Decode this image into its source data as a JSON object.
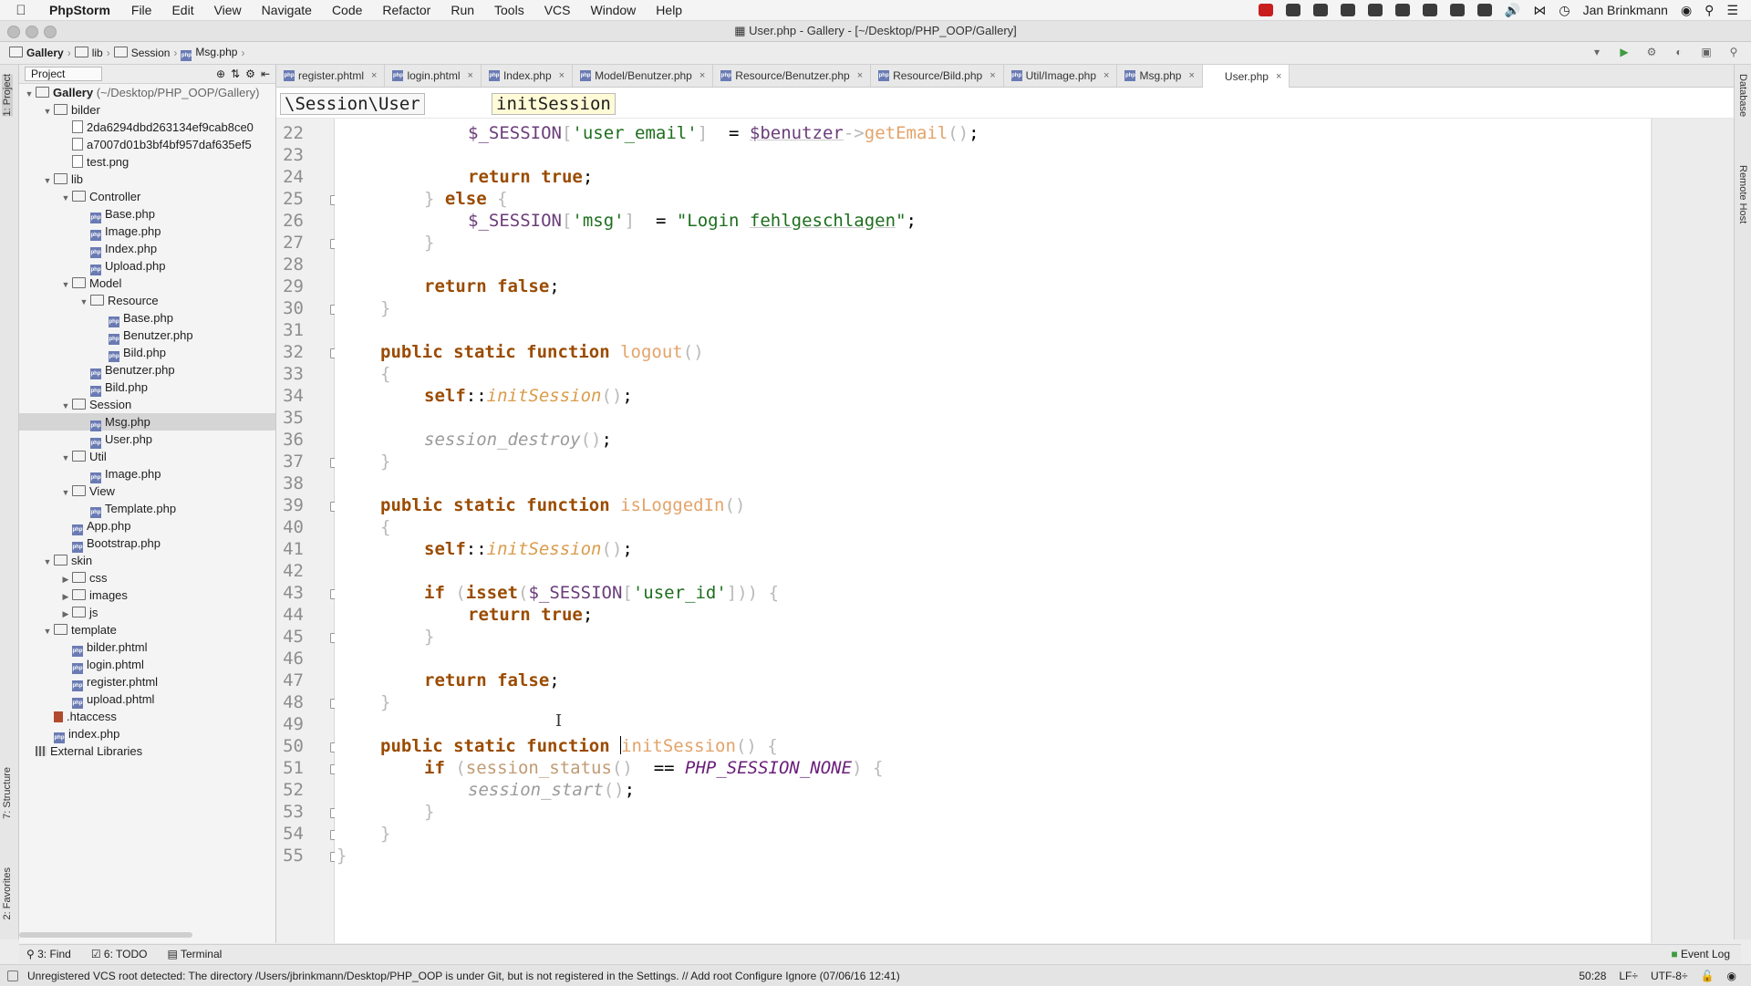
{
  "menubar": {
    "app": "PhpStorm",
    "items": [
      "File",
      "Edit",
      "View",
      "Navigate",
      "Code",
      "Refactor",
      "Run",
      "Tools",
      "VCS",
      "Window",
      "Help"
    ],
    "user": "Jan Brinkmann"
  },
  "window": {
    "title": "User.php - Gallery - [~/Desktop/PHP_OOP/Gallery]"
  },
  "navbar": {
    "crumbs": [
      "Gallery",
      "lib",
      "Session",
      "Msg.php"
    ]
  },
  "sidebar": {
    "strip_tabs": [
      "1: Project",
      "7: Structure",
      "2: Favorites"
    ],
    "header_label": "Project",
    "tree": [
      {
        "label": "Gallery",
        "suffix": " (~/Desktop/PHP_OOP/Gallery)",
        "type": "folder",
        "depth": 0,
        "open": true
      },
      {
        "label": "bilder",
        "type": "folder",
        "depth": 1,
        "open": true
      },
      {
        "label": "2da6294dbd263134ef9cab8ce0",
        "type": "image",
        "depth": 2
      },
      {
        "label": "a7007d01b3bf4bf957daf635ef5",
        "type": "image",
        "depth": 2
      },
      {
        "label": "test.png",
        "type": "image",
        "depth": 2
      },
      {
        "label": "lib",
        "type": "folder",
        "depth": 1,
        "open": true
      },
      {
        "label": "Controller",
        "type": "folder",
        "depth": 2,
        "open": true
      },
      {
        "label": "Base.php",
        "type": "php",
        "depth": 3
      },
      {
        "label": "Image.php",
        "type": "php",
        "depth": 3
      },
      {
        "label": "Index.php",
        "type": "php",
        "depth": 3
      },
      {
        "label": "Upload.php",
        "type": "php",
        "depth": 3
      },
      {
        "label": "Model",
        "type": "folder",
        "depth": 2,
        "open": true
      },
      {
        "label": "Resource",
        "type": "folder",
        "depth": 3,
        "open": true
      },
      {
        "label": "Base.php",
        "type": "php",
        "depth": 4
      },
      {
        "label": "Benutzer.php",
        "type": "php",
        "depth": 4
      },
      {
        "label": "Bild.php",
        "type": "php",
        "depth": 4
      },
      {
        "label": "Benutzer.php",
        "type": "php",
        "depth": 3
      },
      {
        "label": "Bild.php",
        "type": "php",
        "depth": 3
      },
      {
        "label": "Session",
        "type": "folder",
        "depth": 2,
        "open": true
      },
      {
        "label": "Msg.php",
        "type": "php",
        "depth": 3,
        "selected": true
      },
      {
        "label": "User.php",
        "type": "php",
        "depth": 3
      },
      {
        "label": "Util",
        "type": "folder",
        "depth": 2,
        "open": true
      },
      {
        "label": "Image.php",
        "type": "php",
        "depth": 3
      },
      {
        "label": "View",
        "type": "folder",
        "depth": 2,
        "open": true
      },
      {
        "label": "Template.php",
        "type": "php",
        "depth": 3
      },
      {
        "label": "App.php",
        "type": "php",
        "depth": 2
      },
      {
        "label": "Bootstrap.php",
        "type": "php",
        "depth": 2
      },
      {
        "label": "skin",
        "type": "folder",
        "depth": 1,
        "open": true
      },
      {
        "label": "css",
        "type": "folder",
        "depth": 2,
        "open": false
      },
      {
        "label": "images",
        "type": "folder",
        "depth": 2,
        "open": false
      },
      {
        "label": "js",
        "type": "folder",
        "depth": 2,
        "open": false
      },
      {
        "label": "template",
        "type": "folder",
        "depth": 1,
        "open": true
      },
      {
        "label": "bilder.phtml",
        "type": "php",
        "depth": 2
      },
      {
        "label": "login.phtml",
        "type": "php",
        "depth": 2
      },
      {
        "label": "register.phtml",
        "type": "php",
        "depth": 2
      },
      {
        "label": "upload.phtml",
        "type": "php",
        "depth": 2
      },
      {
        "label": ".htaccess",
        "type": "htaccess",
        "depth": 1
      },
      {
        "label": "index.php",
        "type": "php",
        "depth": 1
      },
      {
        "label": "External Libraries",
        "type": "lib",
        "depth": 0
      }
    ]
  },
  "tabs": [
    "register.phtml",
    "login.phtml",
    "Index.php",
    "Model/Benutzer.php",
    "Resource/Benutzer.php",
    "Resource/Bild.php",
    "Util/Image.php",
    "Msg.php",
    "User.php"
  ],
  "active_tab": "User.php",
  "editor_breadcrumb": {
    "class": "\\Session\\User",
    "method": "initSession"
  },
  "right_strip": [
    "Database",
    "Remote Host"
  ],
  "code": [
    {
      "n": "22",
      "indent": 3,
      "tokens": [
        [
          "var",
          "$_SESSION"
        ],
        [
          "br",
          "["
        ],
        [
          "str",
          "'user_email'"
        ],
        [
          "br",
          "]"
        ],
        [
          "",
          "  = "
        ],
        [
          "var ul",
          "$benutzer"
        ],
        [
          "br",
          "->"
        ],
        [
          "fn",
          "getEmail"
        ],
        [
          "br",
          "()"
        ],
        [
          "",
          ";"
        ]
      ]
    },
    {
      "n": "23",
      "indent": 0,
      "tokens": []
    },
    {
      "n": "24",
      "indent": 3,
      "tokens": [
        [
          "kw",
          "return true"
        ],
        [
          "",
          ";"
        ]
      ]
    },
    {
      "n": "25",
      "indent": 2,
      "tokens": [
        [
          "br",
          "} "
        ],
        [
          "kw",
          "else"
        ],
        [
          "br",
          " {"
        ]
      ]
    },
    {
      "n": "26",
      "indent": 3,
      "tokens": [
        [
          "var",
          "$_SESSION"
        ],
        [
          "br",
          "["
        ],
        [
          "str",
          "'msg'"
        ],
        [
          "br",
          "]"
        ],
        [
          "",
          "  = "
        ],
        [
          "str",
          "\"Login "
        ],
        [
          "str ul",
          "fehlgeschlagen"
        ],
        [
          "str",
          "\""
        ],
        [
          "",
          ";"
        ]
      ]
    },
    {
      "n": "27",
      "indent": 2,
      "tokens": [
        [
          "br",
          "}"
        ]
      ]
    },
    {
      "n": "28",
      "indent": 0,
      "tokens": []
    },
    {
      "n": "29",
      "indent": 2,
      "tokens": [
        [
          "kw",
          "return false"
        ],
        [
          "",
          ";"
        ]
      ]
    },
    {
      "n": "30",
      "indent": 1,
      "tokens": [
        [
          "br",
          "}"
        ]
      ]
    },
    {
      "n": "31",
      "indent": 0,
      "tokens": []
    },
    {
      "n": "32",
      "indent": 1,
      "tokens": [
        [
          "kw",
          "public static function "
        ],
        [
          "fn",
          "logout"
        ],
        [
          "br",
          "()"
        ]
      ]
    },
    {
      "n": "33",
      "indent": 1,
      "tokens": [
        [
          "br",
          "{"
        ]
      ]
    },
    {
      "n": "34",
      "indent": 2,
      "tokens": [
        [
          "kw",
          "self"
        ],
        [
          "",
          "::"
        ],
        [
          "ital",
          "initSession"
        ],
        [
          "br",
          "()"
        ],
        [
          "",
          ";"
        ]
      ]
    },
    {
      "n": "35",
      "indent": 0,
      "tokens": []
    },
    {
      "n": "36",
      "indent": 2,
      "tokens": [
        [
          "sf",
          "session_destroy"
        ],
        [
          "br",
          "()"
        ],
        [
          "",
          ";"
        ]
      ]
    },
    {
      "n": "37",
      "indent": 1,
      "tokens": [
        [
          "br",
          "}"
        ]
      ]
    },
    {
      "n": "38",
      "indent": 0,
      "tokens": []
    },
    {
      "n": "39",
      "indent": 1,
      "tokens": [
        [
          "kw",
          "public static function "
        ],
        [
          "fn",
          "isLoggedIn"
        ],
        [
          "br",
          "()"
        ]
      ]
    },
    {
      "n": "40",
      "indent": 1,
      "tokens": [
        [
          "br",
          "{"
        ]
      ]
    },
    {
      "n": "41",
      "indent": 2,
      "tokens": [
        [
          "kw",
          "self"
        ],
        [
          "",
          "::"
        ],
        [
          "ital",
          "initSession"
        ],
        [
          "br",
          "()"
        ],
        [
          "",
          ";"
        ]
      ]
    },
    {
      "n": "42",
      "indent": 0,
      "tokens": []
    },
    {
      "n": "43",
      "indent": 2,
      "tokens": [
        [
          "kw",
          "if "
        ],
        [
          "br",
          "("
        ],
        [
          "kw",
          "isset"
        ],
        [
          "br",
          "("
        ],
        [
          "var",
          "$_SESSION"
        ],
        [
          "br",
          "["
        ],
        [
          "str",
          "'user_id'"
        ],
        [
          "br",
          "]))"
        ],
        [
          "br",
          " {"
        ]
      ]
    },
    {
      "n": "44",
      "indent": 3,
      "tokens": [
        [
          "kw",
          "return true"
        ],
        [
          "",
          ";"
        ]
      ]
    },
    {
      "n": "45",
      "indent": 2,
      "tokens": [
        [
          "br",
          "}"
        ]
      ]
    },
    {
      "n": "46",
      "indent": 0,
      "tokens": []
    },
    {
      "n": "47",
      "indent": 2,
      "tokens": [
        [
          "kw",
          "return false"
        ],
        [
          "",
          ";"
        ]
      ]
    },
    {
      "n": "48",
      "indent": 1,
      "tokens": [
        [
          "br",
          "}"
        ]
      ]
    },
    {
      "n": "49",
      "indent": 0,
      "tokens": []
    },
    {
      "n": "50",
      "indent": 1,
      "tokens": [
        [
          "kw",
          "public static function "
        ],
        [
          "caret",
          ""
        ],
        [
          "fn",
          "initSession"
        ],
        [
          "br",
          "() {"
        ]
      ]
    },
    {
      "n": "51",
      "indent": 2,
      "tokens": [
        [
          "kw",
          "if "
        ],
        [
          "br",
          "("
        ],
        [
          "fnc",
          "session_status"
        ],
        [
          "br",
          "()"
        ],
        [
          "",
          "  == "
        ],
        [
          "const",
          "PHP_SESSION_NONE"
        ],
        [
          "br",
          ") {"
        ]
      ]
    },
    {
      "n": "52",
      "indent": 3,
      "tokens": [
        [
          "sf",
          "session_start"
        ],
        [
          "br",
          "()"
        ],
        [
          "",
          ";"
        ]
      ]
    },
    {
      "n": "53",
      "indent": 2,
      "tokens": [
        [
          "br",
          "}"
        ]
      ]
    },
    {
      "n": "54",
      "indent": 1,
      "tokens": [
        [
          "br",
          "}"
        ]
      ]
    },
    {
      "n": "55",
      "indent": 0,
      "tokens": [
        [
          "br",
          "}"
        ]
      ]
    }
  ],
  "folds": [
    "25",
    "27",
    "30",
    "32",
    "37",
    "39",
    "43",
    "45",
    "48",
    "50",
    "51",
    "53",
    "54",
    "55"
  ],
  "bottom_tools": [
    "3: Find",
    "6: TODO",
    "Terminal"
  ],
  "event_log": "Event Log",
  "status": {
    "message": "Unregistered VCS root detected: The directory /Users/jbrinkmann/Desktop/PHP_OOP is under Git, but is not registered in the Settings. // Add root  Configure  Ignore (07/06/16 12:41)",
    "position": "50:28",
    "line_sep": "LF÷",
    "encoding": "UTF-8÷"
  }
}
